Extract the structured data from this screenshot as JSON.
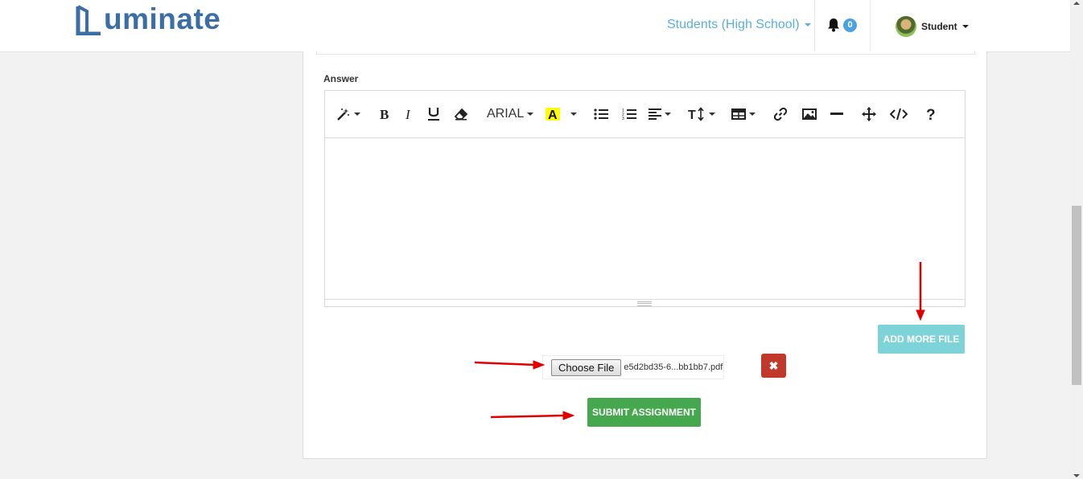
{
  "brand": {
    "name": "uminate",
    "color": "#3a6ea5"
  },
  "nav": {
    "school_selector": "Students (High School)",
    "notifications_count": "0",
    "user_label": "Student"
  },
  "form": {
    "answer_label": "Answer",
    "editor": {
      "font_name": "ARIAL",
      "toolbar_icons": [
        "magic-icon",
        "bold-icon",
        "italic-icon",
        "underline-icon",
        "eraser-icon",
        "font-family",
        "highlight-color-icon",
        "unordered-list-icon",
        "ordered-list-icon",
        "align-icon",
        "text-height-icon",
        "table-icon",
        "link-icon",
        "image-icon",
        "horizontal-rule-icon",
        "fullscreen-icon",
        "code-view-icon",
        "help-icon"
      ],
      "content": ""
    },
    "add_more_file_label": "ADD MORE FILE",
    "file_input": {
      "button_label": "Choose File",
      "file_name": "e5d2bd35-6...bb1bb7.pdf"
    },
    "remove_file_label": "✖",
    "submit_label": "SUBMIT ASSIGNMENT"
  },
  "colors": {
    "accent_blue": "#5aaee4",
    "add_button": "#7ed3d9",
    "submit_button": "#45a84e",
    "remove_button": "#c0392b",
    "annotation_arrow": "#e00000"
  }
}
